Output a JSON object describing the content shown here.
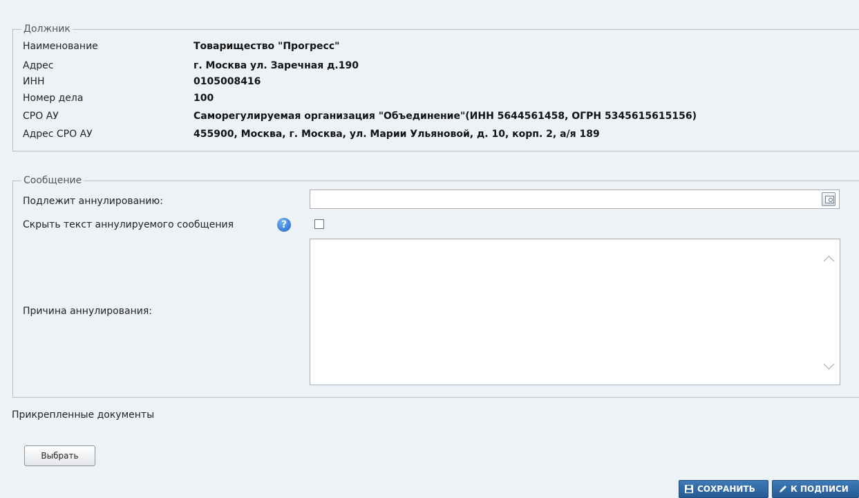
{
  "debtor": {
    "legend": "Должник",
    "rows": [
      {
        "label": "Наименование",
        "value": "Товарищество \"Прогресс\""
      },
      {
        "label": "Адрес",
        "value": "г. Москва ул. Заречная д.190"
      },
      {
        "label": "ИНН",
        "value": "0105008416"
      },
      {
        "label": "Номер дела",
        "value": "100"
      },
      {
        "label": "СРО АУ",
        "value": "Саморегулируемая организация \"Объединение\"(ИНН 5644561458, ОГРН 5345615615156)"
      },
      {
        "label": "Адрес СРО АУ",
        "value": "455900, Москва, г. Москва, ул. Марии Ульяновой, д. 10, корп. 2, а/я 189"
      }
    ]
  },
  "message": {
    "legend": "Сообщение",
    "annul_label": "Подлежит аннулированию:",
    "annul_value": "",
    "hide_label": "Скрыть текст аннулируемого сообщения",
    "hide_checked": false,
    "reason_label": "Причина аннулирования:",
    "reason_value": ""
  },
  "attachments": {
    "title": "Прикрепленные документы",
    "choose_label": "Выбрать"
  },
  "actions": {
    "save_label": "СОХРАНИТЬ",
    "sign_label": "К ПОДПИСИ"
  },
  "icons": {
    "lookup": "magnifier-icon",
    "help": "help-icon",
    "save": "floppy-icon",
    "sign": "pencil-icon"
  },
  "colors": {
    "background": "#edf2f7",
    "button": "#2e67a3",
    "help": "#1f66c7"
  }
}
